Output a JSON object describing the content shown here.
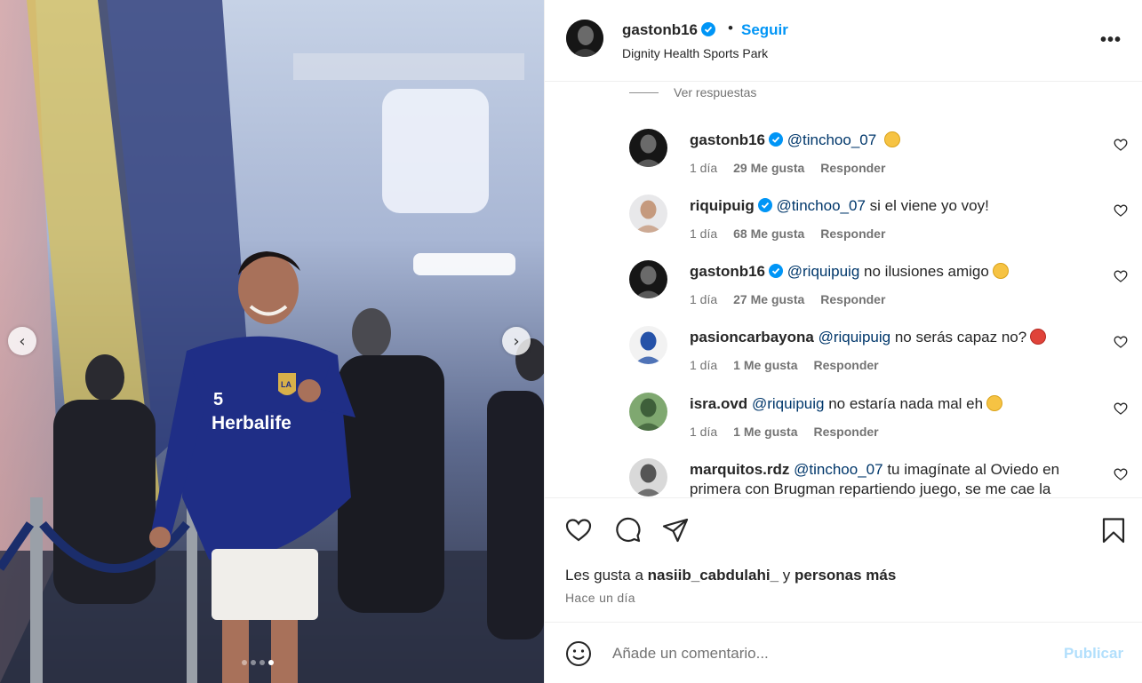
{
  "post": {
    "username": "gastonb16",
    "separator": "•",
    "follow_label": "Seguir",
    "location": "Dignity Health Sports Park",
    "more_label": "•••"
  },
  "photo": {
    "prev_label": "‹",
    "next_label": "›",
    "slide_count": 4,
    "active_slide": 4,
    "jersey_number": "5",
    "sponsor": "Herbalife",
    "crest": "LA"
  },
  "comments": {
    "view_replies": "Ver respuestas",
    "items": [
      {
        "user": "gastonb16",
        "verified": true,
        "mention": "@tinchoo_07",
        "text": "",
        "emoji": "grin",
        "time": "1 día",
        "likes": "29 Me gusta",
        "reply": "Responder"
      },
      {
        "user": "riquipuig",
        "verified": true,
        "mention": "@tinchoo_07",
        "text": "si el viene yo voy!",
        "emoji": "",
        "time": "1 día",
        "likes": "68 Me gusta",
        "reply": "Responder"
      },
      {
        "user": "gastonb16",
        "verified": true,
        "mention": "@riquipuig",
        "text": "no ilusiones amigo",
        "emoji": "star-eyes",
        "time": "1 día",
        "likes": "27 Me gusta",
        "reply": "Responder"
      },
      {
        "user": "pasioncarbayona",
        "verified": false,
        "mention": "@riquipuig",
        "text": "no serás capaz no?",
        "emoji": "angry",
        "time": "1 día",
        "likes": "1 Me gusta",
        "reply": "Responder"
      },
      {
        "user": "isra.ovd",
        "verified": false,
        "mention": "@riquipuig",
        "text": "no estaría nada mal eh",
        "emoji": "tongue",
        "time": "1 día",
        "likes": "1 Me gusta",
        "reply": "Responder"
      },
      {
        "user": "marquitos.rdz",
        "verified": false,
        "mention": "@tinchoo_07",
        "text": "tu imagínate al Oviedo en primera con Brugman repartiendo juego, se me cae la",
        "emoji": "",
        "time": "",
        "likes": "",
        "reply": ""
      }
    ]
  },
  "actions": {
    "icons": [
      "heart-icon",
      "comment-icon",
      "share-icon",
      "bookmark-icon"
    ],
    "likes_prefix": "Les gusta a",
    "liked_by": "nasiib_cabdulahi_",
    "likes_and": "y",
    "likes_others": "personas más",
    "time": "Hace un día"
  },
  "comment_box": {
    "placeholder": "Añade un comentario...",
    "publish_label": "Publicar"
  },
  "colors": {
    "link_blue": "#0095f6",
    "mention_blue": "#00376b",
    "publish_disabled": "#b2dffc",
    "verified_blue": "#0095f6",
    "muted_text": "#737373"
  }
}
